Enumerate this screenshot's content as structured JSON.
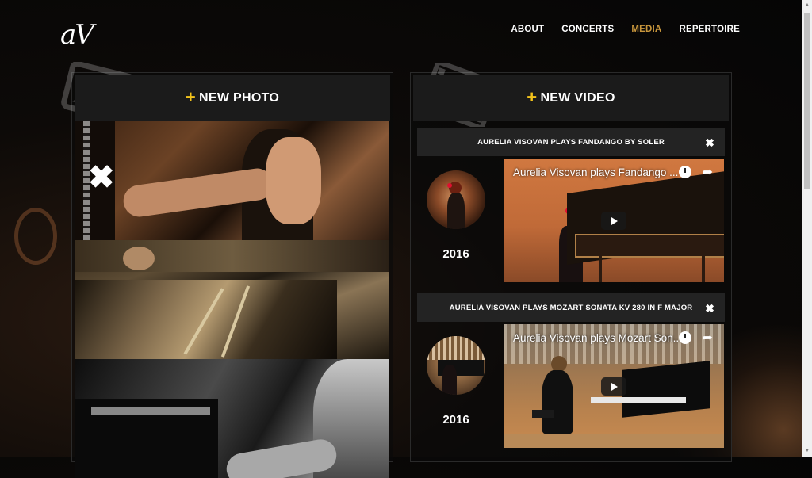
{
  "logo": "aV",
  "nav": {
    "items": [
      {
        "label": "ABOUT",
        "active": false
      },
      {
        "label": "CONCERTS",
        "active": false
      },
      {
        "label": "MEDIA",
        "active": true
      },
      {
        "label": "REPERTOIRE",
        "active": false
      }
    ]
  },
  "photos": {
    "header": "NEW PHOTO",
    "plus": "+",
    "delete_icon": "✖"
  },
  "videos": {
    "header": "NEW VIDEO",
    "plus": "+",
    "items": [
      {
        "title": "AURELIA VISOVAN PLAYS FANDANGO BY SOLER",
        "year": "2016",
        "player_title": "Aurelia Visovan plays Fandango ...",
        "close": "✖"
      },
      {
        "title": "AURELIA VISOVAN PLAYS MOZART SONATA KV 280 IN F MAJOR",
        "year": "2016",
        "player_title": "Aurelia Visovan plays Mozart Son...",
        "close": "✖"
      }
    ]
  },
  "colors": {
    "accent": "#c8963c",
    "plus": "#f2c21b",
    "panel_header": "#1b1b1b",
    "video_bar": "#232323"
  }
}
